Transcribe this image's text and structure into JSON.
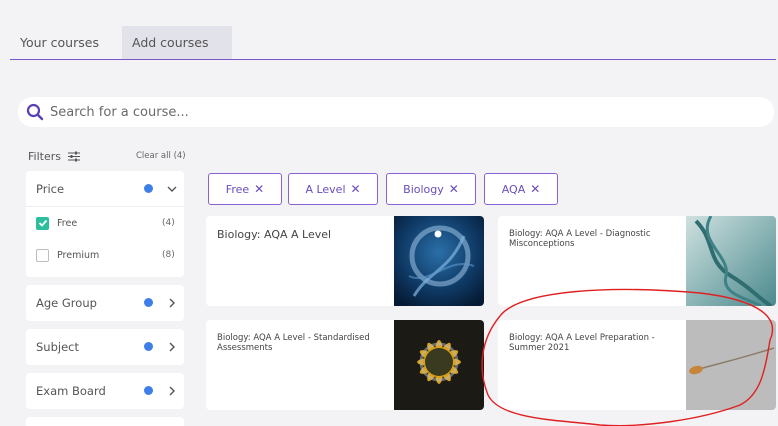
{
  "tabs": [
    {
      "label": "Your courses",
      "active": false
    },
    {
      "label": "Add courses",
      "active": true
    }
  ],
  "search": {
    "placeholder": "Search for a course..."
  },
  "filters": {
    "title": "Filters",
    "clear_all": "Clear all (4)",
    "price": {
      "label": "Price",
      "options": [
        {
          "label": "Free",
          "count": "(4)",
          "checked": true
        },
        {
          "label": "Premium",
          "count": "(8)",
          "checked": false
        }
      ]
    },
    "age_group": {
      "label": "Age Group"
    },
    "subject": {
      "label": "Subject"
    },
    "exam_board": {
      "label": "Exam Board"
    }
  },
  "active_chips": [
    {
      "label": "Free"
    },
    {
      "label": "A Level"
    },
    {
      "label": "Biology"
    },
    {
      "label": "AQA"
    }
  ],
  "courses": [
    {
      "title": "Biology: AQA A Level",
      "image": "dna-helix-dark-blue"
    },
    {
      "title": "Biology: AQA A Level - Diagnostic Misconceptions",
      "image": "dna-strand-teal"
    },
    {
      "title": "Biology: AQA A Level - Standardised Assessments",
      "image": "sunflower"
    },
    {
      "title": "Biology: AQA A Level Preparation - Summer 2021",
      "image": "sperm-cell"
    }
  ],
  "colors": {
    "accent": "#7a57c7",
    "dot": "#3e7ee8",
    "checkbox": "#2bbf9e",
    "annotation": "#e02020"
  },
  "x_glyph": "✕"
}
